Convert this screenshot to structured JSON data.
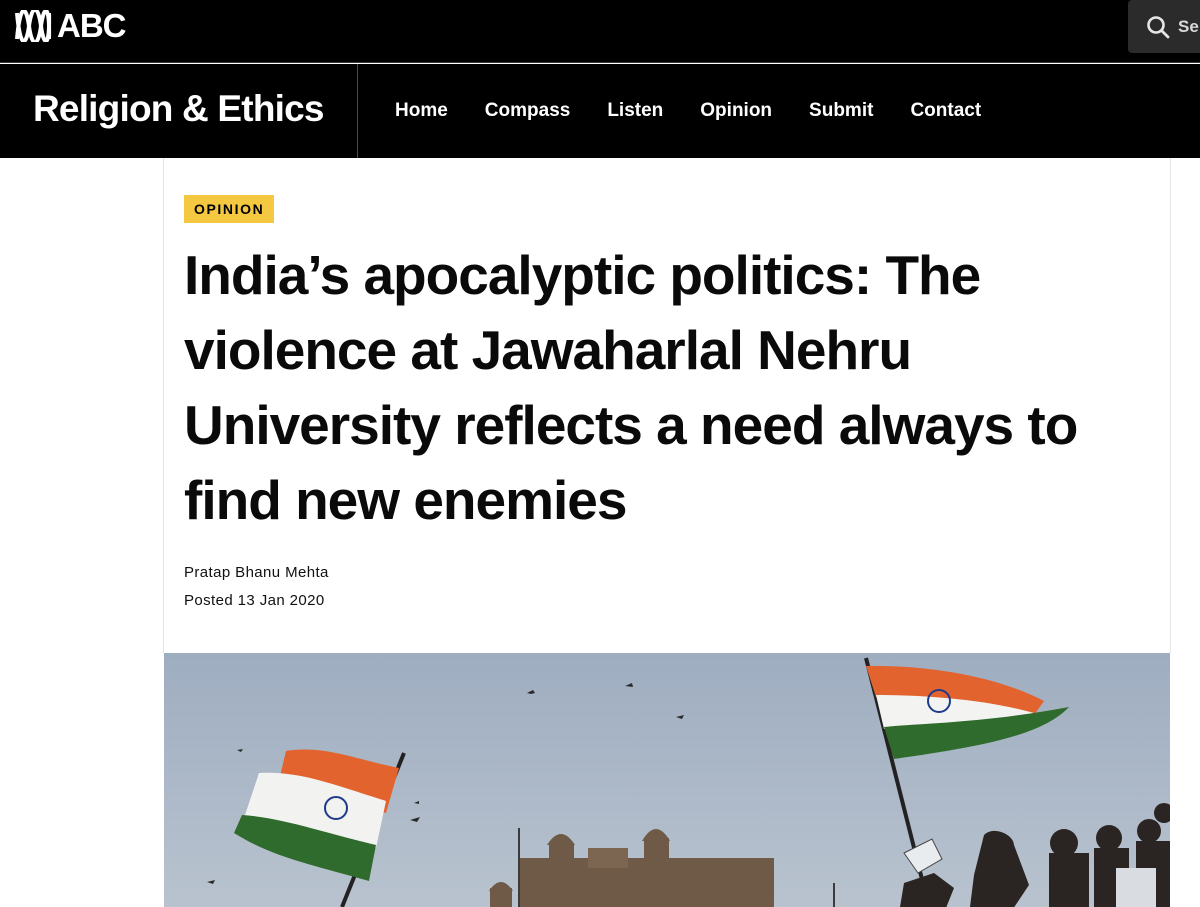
{
  "abc_bar": {
    "logo_text": "ABC",
    "search_placeholder": "Se"
  },
  "section_nav": {
    "title": "Religion & Ethics",
    "items": [
      {
        "label": "Home"
      },
      {
        "label": "Compass"
      },
      {
        "label": "Listen"
      },
      {
        "label": "Opinion"
      },
      {
        "label": "Submit"
      },
      {
        "label": "Contact"
      }
    ]
  },
  "article": {
    "tag": "OPINION",
    "headline": "India’s apocalyptic politics: The violence at Jawaharlal Nehru University reflects a need always to find new enemies",
    "author": "Pratap Bhanu Mehta",
    "posted": "Posted 13 Jan 2020"
  },
  "hero_image": {
    "depicts": "photo of protesters waving Indian flags"
  },
  "colors": {
    "header_bg": "#000000",
    "tag_bg": "#f5c842",
    "flag_saffron": "#e2632e",
    "flag_green": "#2f6b2c",
    "sky": "#a9b6c6"
  }
}
